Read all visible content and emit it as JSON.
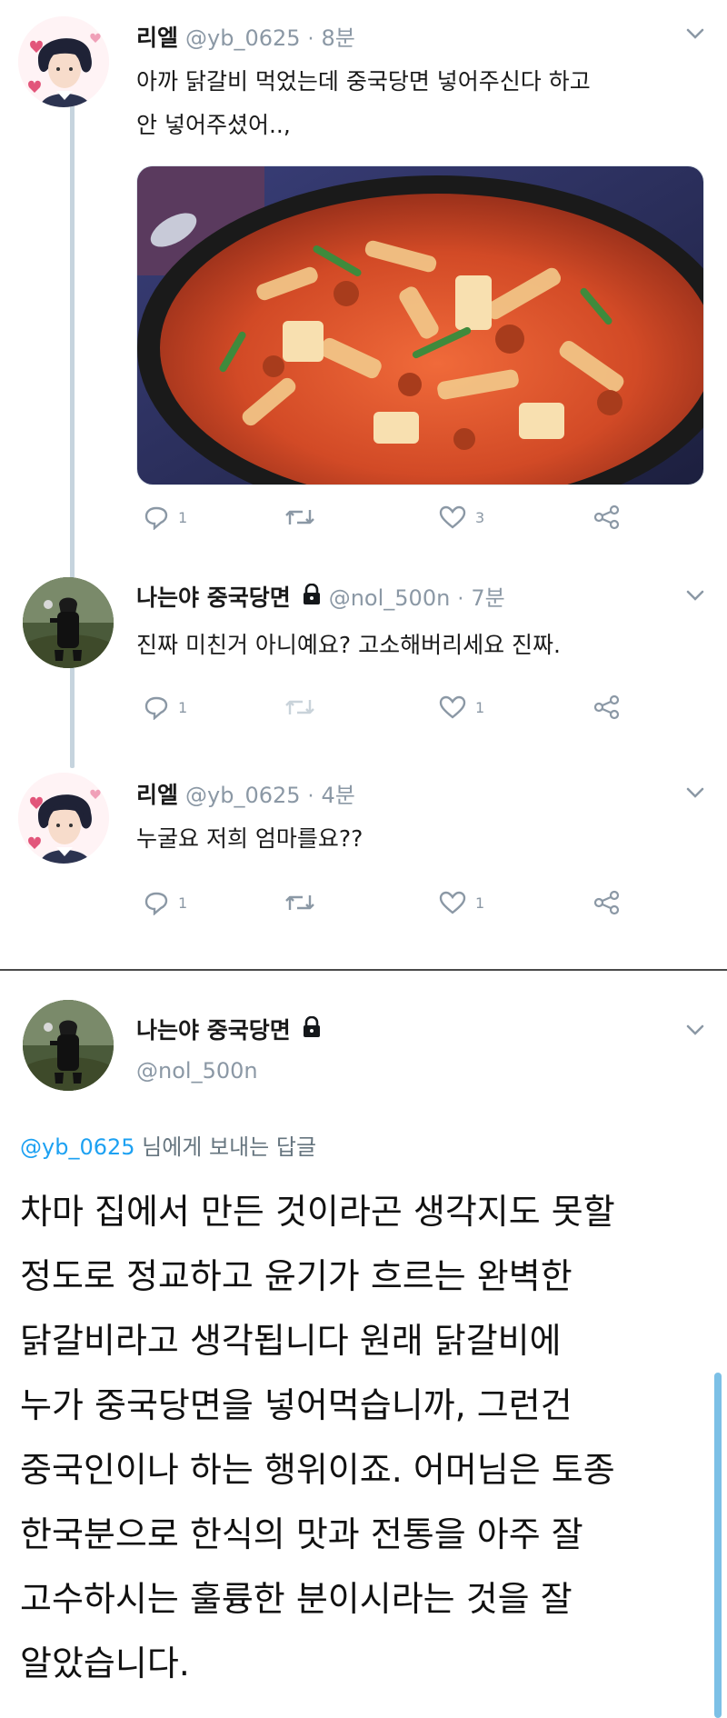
{
  "thread": {
    "tweets": [
      {
        "author_name": "리엘",
        "handle": "@yb_0625",
        "separator": "·",
        "time": "8분",
        "text_lines": [
          "아까 닭갈비 먹었는데 중국당면 넣어주신다 하고",
          "안 넣어주셨어..,"
        ],
        "counts": {
          "reply": "1",
          "retweet": "",
          "like": "3"
        }
      },
      {
        "author_name": "나는야 중국당면",
        "handle": "@nol_500n",
        "separator": "·",
        "time": "7분",
        "text_lines": [
          "진짜 미친거 아니예요? 고소해버리세요 진짜."
        ],
        "counts": {
          "reply": "1",
          "retweet": "",
          "like": "1"
        }
      },
      {
        "author_name": "리엘",
        "handle": "@yb_0625",
        "separator": "·",
        "time": "4분",
        "text_lines": [
          "누굴요 저희 엄마를요??"
        ],
        "counts": {
          "reply": "1",
          "retweet": "",
          "like": "1"
        }
      }
    ]
  },
  "detail": {
    "author_name": "나는야 중국당면",
    "handle": "@nol_500n",
    "reply_to_handle": "@yb_0625",
    "reply_to_suffix": " 님에게 보내는 답글",
    "text_lines": [
      "차마 집에서 만든 것이라곤 생각지도 못할",
      "정도로 정교하고 윤기가 흐르는 완벽한",
      "닭갈비라고 생각됩니다 원래 닭갈비에",
      "누가 중국당면을 넣어먹습니까, 그런건",
      "중국인이나 하는 행위이죠. 어머님은 토종",
      "한국분으로 한식의 맛과 전통을 아주 잘",
      "고수하시는 훌륭한 분이시라는 것을 잘",
      "알았습니다."
    ]
  },
  "colors": {
    "accent": "#1da1f2",
    "muted": "#8b98a5",
    "thread_line": "#c6d4de"
  },
  "icons": [
    "reply-icon",
    "retweet-icon",
    "like-icon",
    "share-icon",
    "lock-icon",
    "chevron-down-icon"
  ]
}
